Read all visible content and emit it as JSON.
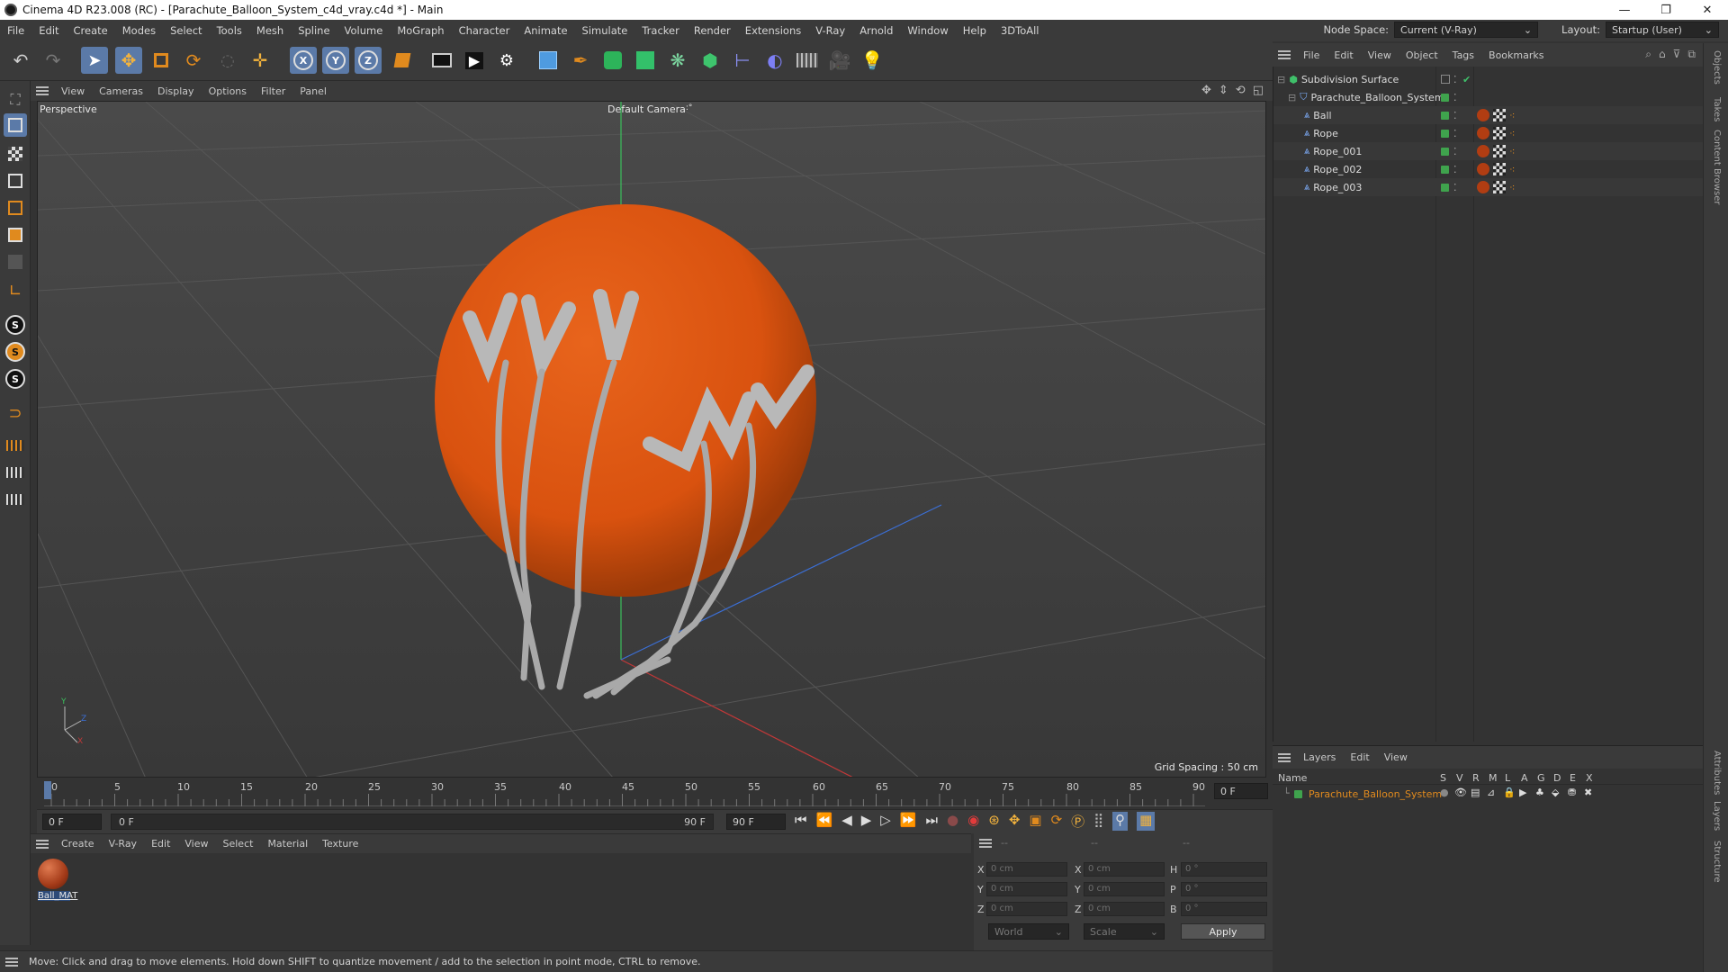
{
  "window": {
    "title": "Cinema 4D R23.008 (RC) - [Parachute_Balloon_System_c4d_vray.c4d *] - Main",
    "minimize": "—",
    "maximize": "❐",
    "close": "✕"
  },
  "menubar": {
    "items": [
      "File",
      "Edit",
      "Create",
      "Modes",
      "Select",
      "Tools",
      "Mesh",
      "Spline",
      "Volume",
      "MoGraph",
      "Character",
      "Animate",
      "Simulate",
      "Tracker",
      "Render",
      "Extensions",
      "V-Ray",
      "Arnold",
      "Window",
      "Help",
      "3DToAll"
    ],
    "node_space_label": "Node Space:",
    "node_space_value": "Current (V-Ray)",
    "layout_label": "Layout:",
    "layout_value": "Startup (User)"
  },
  "viewport": {
    "menu": [
      "View",
      "Cameras",
      "Display",
      "Options",
      "Filter",
      "Panel"
    ],
    "name": "Perspective",
    "camera": "Default Camera",
    "camera_suffix": ":°",
    "grid_spacing": "Grid Spacing : 50 cm",
    "axis_y": "Y",
    "axis_z": "Z",
    "axis_x": "X",
    "balloon_color": "#d9520f",
    "rope_color": "#a9a9a9"
  },
  "timeline": {
    "ticks": [
      "0",
      "5",
      "10",
      "15",
      "20",
      "25",
      "30",
      "35",
      "40",
      "45",
      "50",
      "55",
      "60",
      "65",
      "70",
      "75",
      "80",
      "85",
      "90"
    ],
    "current_frame": "0 F",
    "start_field": "0 F",
    "range_start": "0 F",
    "range_end": "90 F",
    "end_field": "90 F"
  },
  "material_manager": {
    "menu": [
      "Create",
      "V-Ray",
      "Edit",
      "View",
      "Select",
      "Material",
      "Texture"
    ],
    "materials": [
      {
        "name": "Ball_MAT"
      }
    ]
  },
  "coordinates": {
    "headers": [
      "--",
      "--",
      "--"
    ],
    "pos_labels": [
      "X",
      "Y",
      "Z"
    ],
    "size_labels": [
      "X",
      "Y",
      "Z"
    ],
    "rot_labels": [
      "H",
      "P",
      "B"
    ],
    "pos_values": [
      "0 cm",
      "0 cm",
      "0 cm"
    ],
    "size_values": [
      "0 cm",
      "0 cm",
      "0 cm"
    ],
    "rot_values": [
      "0 °",
      "0 °",
      "0 °"
    ],
    "mode": "World",
    "transform": "Scale",
    "apply": "Apply"
  },
  "object_manager": {
    "menu": [
      "File",
      "Edit",
      "View",
      "Object",
      "Tags",
      "Bookmarks"
    ],
    "objects": [
      {
        "name": "Subdivision Surface",
        "indent": 0
      },
      {
        "name": "Parachute_Balloon_System",
        "indent": 1
      },
      {
        "name": "Ball",
        "indent": 2
      },
      {
        "name": "Rope",
        "indent": 2
      },
      {
        "name": "Rope_001",
        "indent": 2
      },
      {
        "name": "Rope_002",
        "indent": 2
      },
      {
        "name": "Rope_003",
        "indent": 2
      }
    ]
  },
  "layer_manager": {
    "menu": [
      "Layers",
      "Edit",
      "View"
    ],
    "name_header": "Name",
    "flag_headers": [
      "S",
      "V",
      "R",
      "M",
      "L",
      "A",
      "G",
      "D",
      "E",
      "X"
    ],
    "layers": [
      {
        "name": "Parachute_Balloon_System",
        "color": "#3fa34d"
      }
    ]
  },
  "side_tabs": [
    "Objects",
    "Takes",
    "Content Browser",
    "Attributes",
    "Layers",
    "Structure"
  ],
  "status": "Move: Click and drag to move elements. Hold down SHIFT to quantize movement / add to the selection in point mode, CTRL to remove."
}
